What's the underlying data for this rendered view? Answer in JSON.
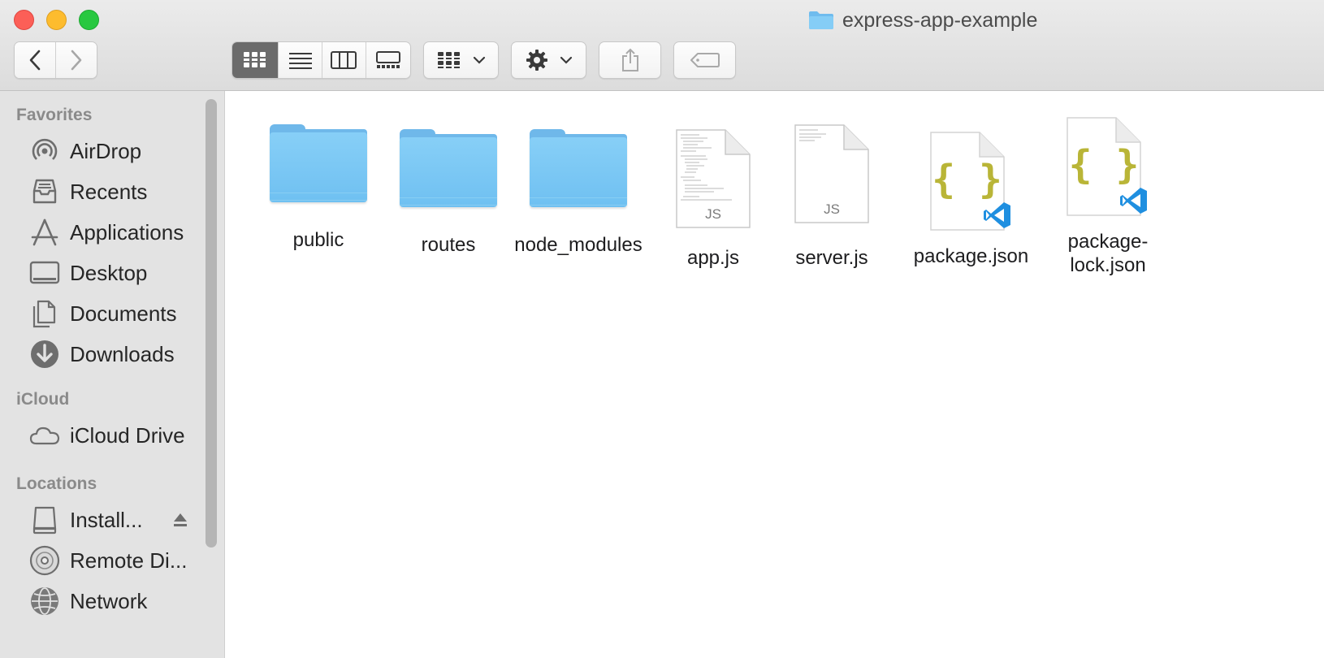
{
  "window": {
    "title": "express-app-example"
  },
  "toolbar": {
    "back": "‹",
    "forward": "›"
  },
  "sidebar": {
    "favorites_header": "Favorites",
    "icloud_header": "iCloud",
    "locations_header": "Locations",
    "favorites": [
      {
        "label": "AirDrop",
        "icon": "airdrop-icon"
      },
      {
        "label": "Recents",
        "icon": "recents-icon"
      },
      {
        "label": "Applications",
        "icon": "applications-icon"
      },
      {
        "label": "Desktop",
        "icon": "desktop-icon"
      },
      {
        "label": "Documents",
        "icon": "documents-icon"
      },
      {
        "label": "Downloads",
        "icon": "downloads-icon"
      }
    ],
    "icloud": [
      {
        "label": "iCloud Drive",
        "icon": "cloud-icon"
      }
    ],
    "locations": [
      {
        "label": "Install...",
        "icon": "drive-icon"
      },
      {
        "label": "Remote Di...",
        "icon": "disc-icon"
      },
      {
        "label": "Network",
        "icon": "network-icon"
      }
    ]
  },
  "files": [
    {
      "name": "public",
      "kind": "folder"
    },
    {
      "name": "routes",
      "kind": "folder"
    },
    {
      "name": "node_modules",
      "kind": "folder"
    },
    {
      "name": "app.js",
      "kind": "js",
      "badge": "JS"
    },
    {
      "name": "server.js",
      "kind": "js",
      "badge": "JS"
    },
    {
      "name": "package.json",
      "kind": "json",
      "badge": "{ }"
    },
    {
      "name": "package-lock.json",
      "kind": "json",
      "badge": "{ }"
    }
  ],
  "colors": {
    "accent_folder": "#78c4f3",
    "json_brace": "#b9b537",
    "vscode_blue": "#1f8fe0"
  }
}
